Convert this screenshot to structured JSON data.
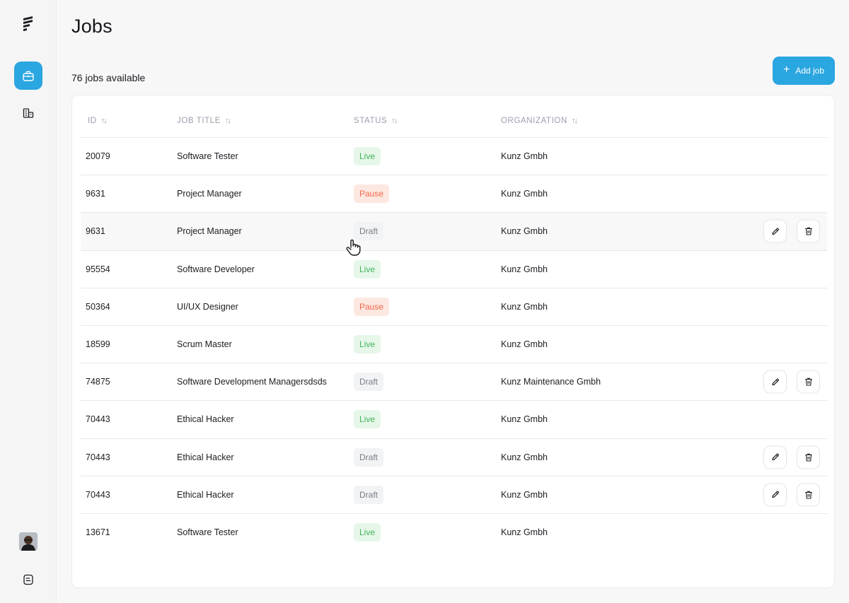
{
  "sidebar": {
    "icons": [
      "logo-icon",
      "briefcase-icon",
      "building-icon",
      "avatar",
      "logout-icon"
    ]
  },
  "header": {
    "title": "Jobs",
    "count_text": "76 jobs available",
    "add_button_label": "Add job",
    "add_button_icon": "+"
  },
  "table": {
    "columns": {
      "id": "ID",
      "title": "JOB TITLE",
      "status": "STATUS",
      "org": "ORGANIZATION",
      "sort_glyph": "↑↓"
    },
    "rows": [
      {
        "id": "20079",
        "title": "Software Tester",
        "status": "Live",
        "status_kind": "live",
        "org": "Kunz Gmbh",
        "actions": false
      },
      {
        "id": "9631",
        "title": "Project Manager",
        "status": "Pause",
        "status_kind": "pause",
        "org": "Kunz Gmbh",
        "actions": false
      },
      {
        "id": "9631",
        "title": "Project Manager",
        "status": "Draft",
        "status_kind": "draft",
        "org": "Kunz Gmbh",
        "actions": true,
        "hover": true
      },
      {
        "id": "95554",
        "title": "Software Developer",
        "status": "Live",
        "status_kind": "live",
        "org": "Kunz Gmbh",
        "actions": false
      },
      {
        "id": "50364",
        "title": "UI/UX Designer",
        "status": "Pause",
        "status_kind": "pause",
        "org": "Kunz Gmbh",
        "actions": false
      },
      {
        "id": "18599",
        "title": "Scrum Master",
        "status": "Live",
        "status_kind": "live",
        "org": "Kunz Gmbh",
        "actions": false
      },
      {
        "id": "74875",
        "title": "Software Development Managersdsds",
        "status": "Draft",
        "status_kind": "draft",
        "org": "Kunz  Maintenance Gmbh",
        "actions": true
      },
      {
        "id": "70443",
        "title": "Ethical Hacker",
        "status": "Live",
        "status_kind": "live",
        "org": "Kunz Gmbh",
        "actions": false
      },
      {
        "id": "70443",
        "title": "Ethical Hacker",
        "status": "Draft",
        "status_kind": "draft",
        "org": "Kunz Gmbh",
        "actions": true
      },
      {
        "id": "70443",
        "title": "Ethical Hacker",
        "status": "Draft",
        "status_kind": "draft",
        "org": "Kunz Gmbh",
        "actions": true
      },
      {
        "id": "13671",
        "title": "Software Tester",
        "status": "Live",
        "status_kind": "live",
        "org": "Kunz Gmbh",
        "actions": false
      }
    ]
  },
  "colors": {
    "accent": "#2aa6e0",
    "live_bg": "#e6f7ea",
    "live_fg": "#3fb35a",
    "pause_bg": "#fde7e1",
    "pause_fg": "#ef6b4a",
    "draft_bg": "#f2f3f5",
    "draft_fg": "#7b7e88"
  }
}
